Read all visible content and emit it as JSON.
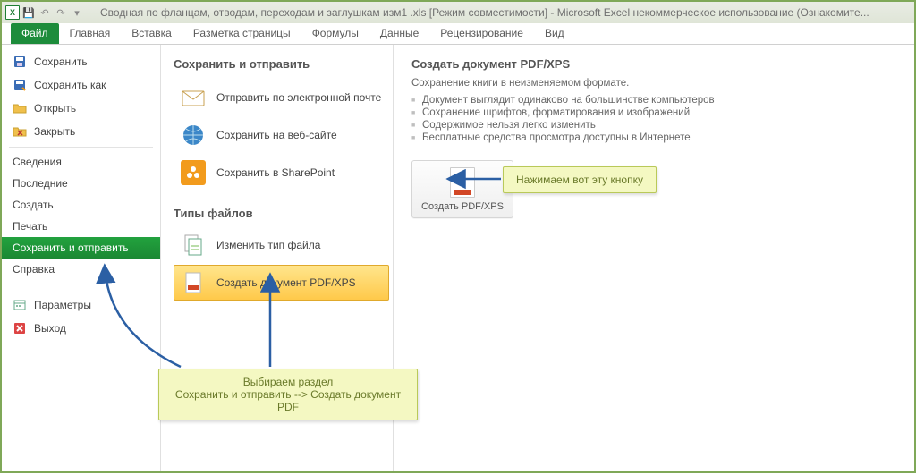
{
  "titlebar": {
    "text": "Сводная по фланцам, отводам, переходам и заглушкам изм1 .xls  [Режим совместимости]  -  Microsoft Excel некоммерческое использование (Ознакомите..."
  },
  "ribbon": {
    "tabs": [
      "Файл",
      "Главная",
      "Вставка",
      "Разметка страницы",
      "Формулы",
      "Данные",
      "Рецензирование",
      "Вид"
    ]
  },
  "sidebar": {
    "save": "Сохранить",
    "saveas": "Сохранить как",
    "open": "Открыть",
    "close": "Закрыть",
    "info": "Сведения",
    "recent": "Последние",
    "new": "Создать",
    "print": "Печать",
    "savesend": "Сохранить и отправить",
    "help": "Справка",
    "options": "Параметры",
    "exit": "Выход"
  },
  "mid": {
    "h1": "Сохранить и отправить",
    "email": "Отправить по электронной почте",
    "web": "Сохранить на веб-сайте",
    "sp": "Сохранить в SharePoint",
    "h2": "Типы файлов",
    "chtype": "Изменить тип файла",
    "pdf": "Создать документ PDF/XPS"
  },
  "right": {
    "h": "Создать документ PDF/XPS",
    "d": "Сохранение книги в неизменяемом формате.",
    "b1": "Документ выглядит одинаково на большинстве компьютеров",
    "b2": "Сохранение шрифтов, форматирования и изображений",
    "b3": "Содержимое нельзя легко изменить",
    "b4": "Бесплатные средства просмотра доступны в Интернете",
    "btn": "Создать PDF/XPS"
  },
  "callouts": {
    "c1": "Нажимаем вот эту кнопку",
    "c2a": "Выбираем раздел",
    "c2b": "Сохранить и отправить --> Создать документ PDF"
  }
}
